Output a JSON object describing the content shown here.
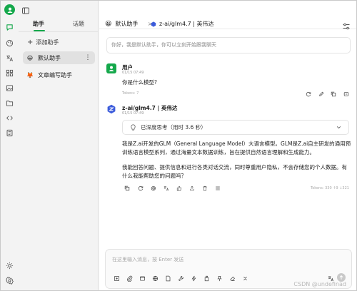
{
  "colors": {
    "accent": "#14a84b",
    "assistant_icon": "#3b5bdb"
  },
  "rail": {
    "icons": [
      "user-avatar-icon",
      "chat-icon",
      "palette-icon",
      "translate-icon",
      "apps-icon",
      "paint-icon",
      "folder-icon",
      "code-icon",
      "notes-icon",
      "sun-icon",
      "settings-icon"
    ]
  },
  "panel": {
    "tabs": [
      "助手",
      "话题"
    ],
    "add_label": "添加助手",
    "assistants": [
      {
        "emoji": "😀",
        "name": "默认助手",
        "active": true
      },
      {
        "emoji": "🦊",
        "name": "文章编写助手",
        "active": false
      }
    ]
  },
  "header": {
    "assistant": "默认助手",
    "separator": ">",
    "model": "z-ai/glm4.7 | 英伟达"
  },
  "system_prompt": {
    "placeholder": "你好，我是默认助手，你可以立刻开始跟我聊天"
  },
  "messages": [
    {
      "name": "用户",
      "time": "01/15 07:49",
      "text": "你是什么模型?",
      "tokens": "Tokens: 7"
    },
    {
      "name": "z-ai/glm4.7 | 英伟达",
      "time": "01/15 07:49",
      "thinking": "已深度思考（用时 3.6 秒）",
      "paragraphs": [
        "我是Z.ai开发的GLM（General Language Model）大语言模型。GLM是Z.ai自主研发的通用预训练语言模型系列，通过海量文本数据训练，旨在提供自然语言理解和生成能力。",
        "我能回答问题、提供信息和进行各类对话交流，同时尊重用户隐私，不会存储您的个人数据。有什么我能帮助您的问题吗？"
      ],
      "tokens": "Tokens: 330 ↑9 ↓321"
    }
  ],
  "input": {
    "placeholder": "在这里输入消息，按 Enter 发送"
  },
  "watermark": "CSDN @undefinad"
}
